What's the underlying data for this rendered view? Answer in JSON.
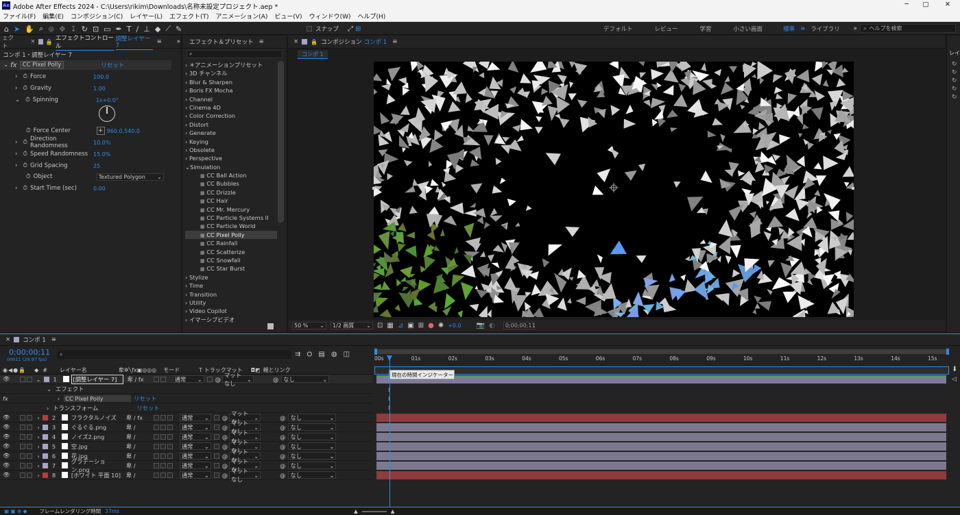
{
  "titlebar": {
    "app_icon": "Ae",
    "title": "Adobe After Effects 2024 - C:\\Users\\rikim\\Downloads\\名称未設定プロジェクト.aep *",
    "min": "─",
    "max": "□",
    "close": "✕"
  },
  "menu": [
    "ファイル(F)",
    "編集(E)",
    "コンポジション(C)",
    "レイヤー(L)",
    "エフェクト(T)",
    "アニメーション(A)",
    "ビュー(V)",
    "ウィンドウ(W)",
    "ヘルプ(H)"
  ],
  "toolbar": {
    "snap": "スナップ",
    "workspaces": [
      "デフォルト",
      "レビュー",
      "学習",
      "小さい画面",
      "標準",
      "ライブラリ"
    ],
    "active_workspace": "標準",
    "more": "»",
    "help_placeholder": "ヘルプを検索"
  },
  "effect_controls": {
    "left_tab": "ェクト",
    "tab": "エフェクトコントロール",
    "tab_target": "調整レイヤー 7",
    "layer_path": "コンポ 1・調整レイヤー 7",
    "effect_name": "CC Pixel Polly",
    "reset": "リセット",
    "props": [
      {
        "name": "Force",
        "value": "100.0"
      },
      {
        "name": "Gravity",
        "value": "1.00"
      },
      {
        "name": "Spinning",
        "value": "1x+0.0°"
      },
      {
        "name": "Force Center",
        "value": "960.0,540.0"
      },
      {
        "name": "Direction Randomness",
        "value": "10.0%"
      },
      {
        "name": "Speed Randomness",
        "value": "15.0%"
      },
      {
        "name": "Grid Spacing",
        "value": "25"
      },
      {
        "name": "Object",
        "value": "Textured Polygon"
      },
      {
        "name": "Start Time (sec)",
        "value": "0.00"
      }
    ]
  },
  "effects_presets": {
    "tab": "エフェクト＆プリセット",
    "search_placeholder": "",
    "categories": [
      "＊アニメーションプリセット",
      "3D チャンネル",
      "Blur & Sharpen",
      "Boris FX Mocha",
      "Channel",
      "Cinema 4D",
      "Color Correction",
      "Distort",
      "Generate",
      "Keying",
      "Obsolete",
      "Perspective",
      "Simulation"
    ],
    "simulation_items": [
      "CC Ball Action",
      "CC Bubbles",
      "CC Drizzle",
      "CC Hair",
      "CC Mr. Mercury",
      "CC Particle Systems II",
      "CC Particle World",
      "CC Pixel Polly",
      "CC Rainfall",
      "CC Scatterize",
      "CC Snowfall",
      "CC Star Burst"
    ],
    "selected": "CC Pixel Polly",
    "after": [
      "Stylize",
      "Time",
      "Transition",
      "Utility",
      "Video Copilot",
      "イマーシブビデオ"
    ]
  },
  "composition": {
    "tab": "コンポジション",
    "tab_name": "コンポ 1",
    "subtab": "コンポ 1",
    "zoom": "50 %",
    "resolution": "1/2 画質",
    "exposure": "+0.0",
    "timecode": "0;00;00;11"
  },
  "right_panel": {
    "label": "レイ"
  },
  "timeline": {
    "tab": "コンポ 1",
    "timecode": "0;00;00;11",
    "frames": "00011 (29.97 fps)",
    "search_placeholder": "",
    "col_layer_name": "レイヤー名",
    "col_mode": "モード",
    "col_track": "T  トラックマット",
    "col_parent": "親とリンク",
    "ruler": [
      "00s",
      "01s",
      "02s",
      "03s",
      "04s",
      "05s",
      "06s",
      "07s",
      "08s",
      "09s",
      "10s",
      "11s",
      "12s",
      "13s",
      "14s",
      "15s"
    ],
    "tooltip": "現在の時間インジケーター",
    "effect_group": "エフェクト",
    "effect_item": "CC Pixel Polly",
    "transform": "トランスフォーム",
    "reset": "リセット",
    "layers": [
      {
        "num": "1",
        "name": "[調整レイヤー 7]",
        "label_color": "#a8a4c8",
        "mode": "通常",
        "matte": "マットなし",
        "parent": "なし",
        "bar": "#7f7a9a"
      },
      {
        "num": "2",
        "name": "フラクタルノイズ",
        "label_color": "#b83a3a",
        "mode": "通常",
        "matte": "マットなし",
        "parent": "なし",
        "bar": "#8e3b3b"
      },
      {
        "num": "3",
        "name": "ぐるぐる.png",
        "label_color": "#a8a4c8",
        "mode": "通常",
        "matte": "マットなし",
        "parent": "なし",
        "bar": "#7c788f"
      },
      {
        "num": "4",
        "name": "ノイズ2.png",
        "label_color": "#a8a4c8",
        "mode": "通常",
        "matte": "マットなし",
        "parent": "なし",
        "bar": "#7c788f"
      },
      {
        "num": "5",
        "name": "空.jpg",
        "label_color": "#a8a4c8",
        "mode": "通常",
        "matte": "マットなし",
        "parent": "なし",
        "bar": "#7c788f"
      },
      {
        "num": "6",
        "name": "花.jpg",
        "label_color": "#a8a4c8",
        "mode": "通常",
        "matte": "マットなし",
        "parent": "なし",
        "bar": "#7c788f"
      },
      {
        "num": "7",
        "name": "グラデーション.png",
        "label_color": "#a8a4c8",
        "mode": "通常",
        "matte": "マットなし",
        "parent": "なし",
        "bar": "#7c788f"
      },
      {
        "num": "8",
        "name": "[ホワイト 平面 10]",
        "label_color": "#b83a3a",
        "mode": "通常",
        "matte": "マットなし",
        "parent": "なし",
        "bar": "#8e3b3b"
      }
    ],
    "footer_label": "フレームレンダリング時間",
    "footer_value": "37ms"
  },
  "colors": {
    "accent": "#2d8ceb",
    "panel": "#232323",
    "dark": "#1d1d1d"
  }
}
